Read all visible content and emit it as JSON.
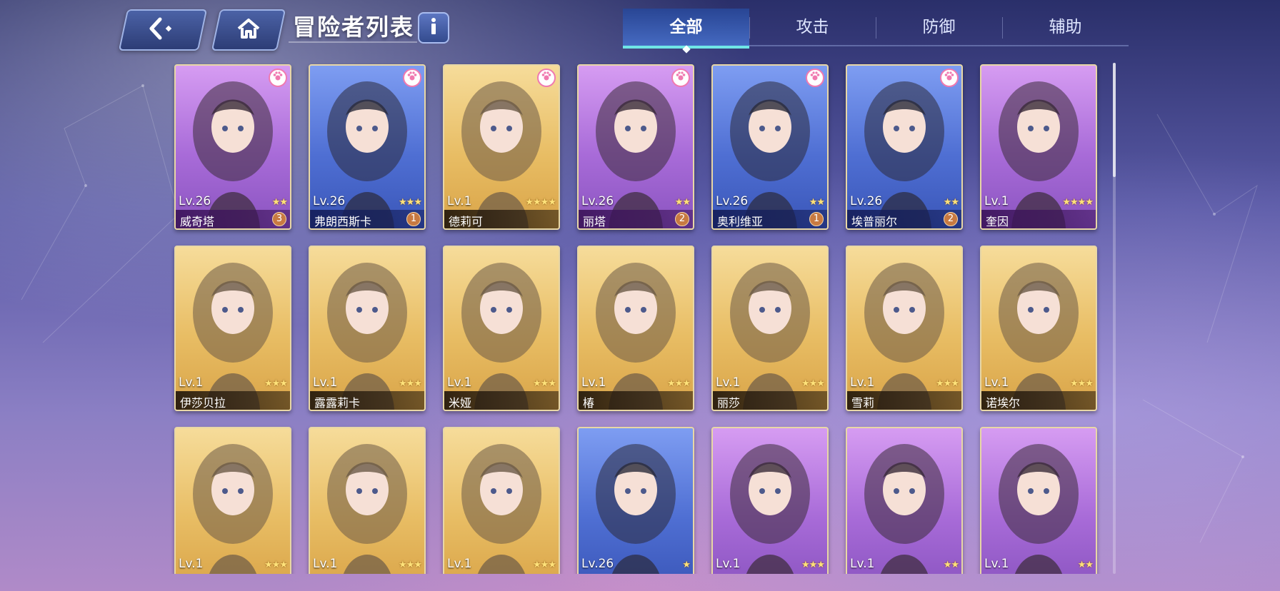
{
  "header": {
    "title": "冒险者列表",
    "back_icon": "back-arrow-icon",
    "home_icon": "home-icon",
    "info_icon": "info-icon"
  },
  "tabs": [
    {
      "label": "全部",
      "active": true
    },
    {
      "label": "攻击",
      "active": false
    },
    {
      "label": "防御",
      "active": false
    },
    {
      "label": "辅助",
      "active": false
    }
  ],
  "colors": {
    "purple_frame": "#b27ae0",
    "blue_frame": "#5a79dc",
    "gold_frame": "#e8bd64",
    "active_tab_accent": "#6fe6e6"
  },
  "cards": [
    {
      "name": "威奇塔",
      "level": "Lv.26",
      "stars": 2,
      "frame": "purple",
      "pet_badge": true,
      "count": "3"
    },
    {
      "name": "弗朗西斯卡",
      "level": "Lv.26",
      "stars": 3,
      "frame": "blue",
      "pet_badge": true,
      "count": "1"
    },
    {
      "name": "德莉可",
      "level": "Lv.1",
      "stars": 4,
      "frame": "gold",
      "pet_badge": true,
      "count": ""
    },
    {
      "name": "丽塔",
      "level": "Lv.26",
      "stars": 2,
      "frame": "purple",
      "pet_badge": true,
      "count": "2"
    },
    {
      "name": "奥利维亚",
      "level": "Lv.26",
      "stars": 2,
      "frame": "blue",
      "pet_badge": true,
      "count": "1"
    },
    {
      "name": "埃普丽尔",
      "level": "Lv.26",
      "stars": 2,
      "frame": "blue",
      "pet_badge": true,
      "count": "2"
    },
    {
      "name": "奎因",
      "level": "Lv.1",
      "stars": 4,
      "frame": "purple",
      "pet_badge": false,
      "count": ""
    },
    {
      "name": "伊莎贝拉",
      "level": "Lv.1",
      "stars": 3,
      "frame": "gold",
      "pet_badge": false,
      "count": ""
    },
    {
      "name": "露露莉卡",
      "level": "Lv.1",
      "stars": 3,
      "frame": "gold",
      "pet_badge": false,
      "count": ""
    },
    {
      "name": "米娅",
      "level": "Lv.1",
      "stars": 3,
      "frame": "gold",
      "pet_badge": false,
      "count": ""
    },
    {
      "name": "椿",
      "level": "Lv.1",
      "stars": 3,
      "frame": "gold",
      "pet_badge": false,
      "count": ""
    },
    {
      "name": "丽莎",
      "level": "Lv.1",
      "stars": 3,
      "frame": "gold",
      "pet_badge": false,
      "count": ""
    },
    {
      "name": "雪莉",
      "level": "Lv.1",
      "stars": 3,
      "frame": "gold",
      "pet_badge": false,
      "count": ""
    },
    {
      "name": "诺埃尔",
      "level": "Lv.1",
      "stars": 3,
      "frame": "gold",
      "pet_badge": false,
      "count": ""
    },
    {
      "name": "",
      "level": "Lv.1",
      "stars": 3,
      "frame": "gold",
      "pet_badge": false,
      "count": ""
    },
    {
      "name": "",
      "level": "Lv.1",
      "stars": 3,
      "frame": "gold",
      "pet_badge": false,
      "count": ""
    },
    {
      "name": "",
      "level": "Lv.1",
      "stars": 3,
      "frame": "gold",
      "pet_badge": false,
      "count": ""
    },
    {
      "name": "",
      "level": "Lv.26",
      "stars": 1,
      "frame": "blue",
      "pet_badge": false,
      "count": ""
    },
    {
      "name": "",
      "level": "Lv.1",
      "stars": 3,
      "frame": "purple",
      "pet_badge": false,
      "count": ""
    },
    {
      "name": "",
      "level": "Lv.1",
      "stars": 2,
      "frame": "purple",
      "pet_badge": false,
      "count": ""
    },
    {
      "name": "",
      "level": "Lv.1",
      "stars": 2,
      "frame": "purple",
      "pet_badge": false,
      "count": ""
    }
  ]
}
